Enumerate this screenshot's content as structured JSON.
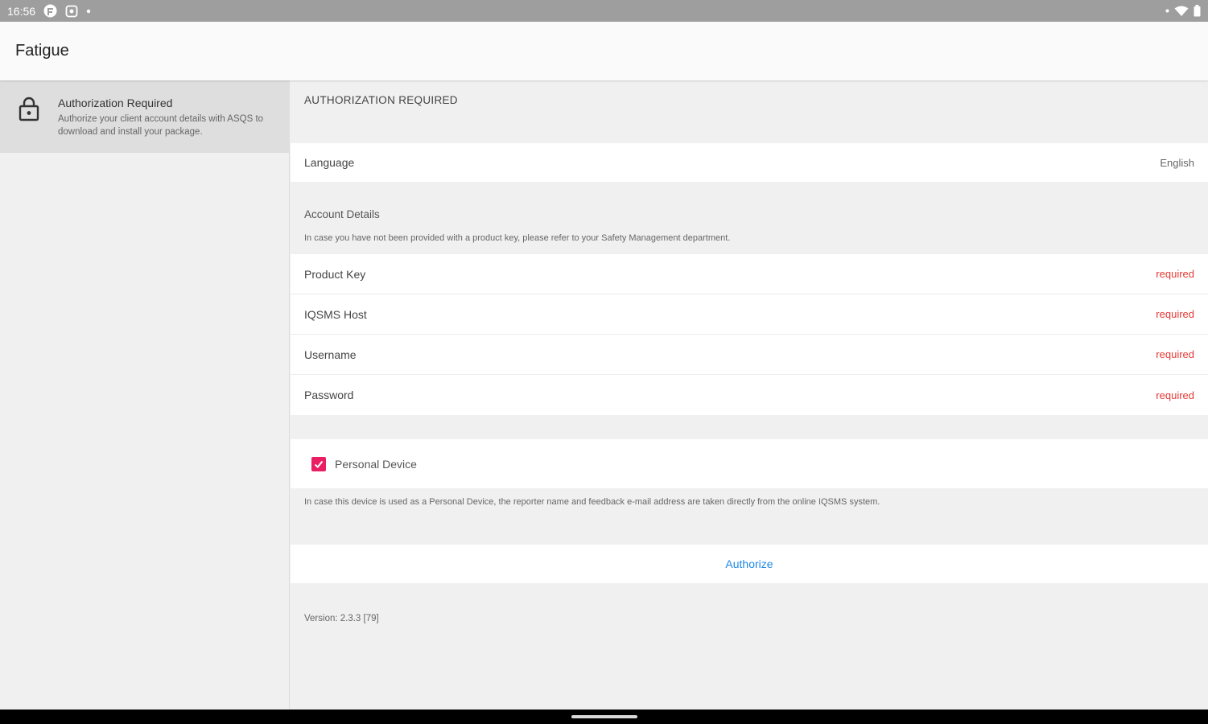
{
  "status_bar": {
    "time": "16:56",
    "icons": [
      "app-notification-icon",
      "settings-notification-icon",
      "dot-icon",
      "wifi-icon",
      "battery-icon"
    ]
  },
  "app_bar": {
    "title": "Fatigue"
  },
  "sidebar": {
    "items": [
      {
        "icon": "lock-icon",
        "title": "Authorization Required",
        "subtitle": "Authorize your client account details with ASQS to download and install your package."
      }
    ]
  },
  "main": {
    "section_header": "AUTHORIZATION REQUIRED",
    "language": {
      "label": "Language",
      "value": "English"
    },
    "account_details": {
      "title": "Account Details",
      "note": "In case you have not been provided with a product key, please refer to your Safety Management department."
    },
    "fields": [
      {
        "label": "Product Key",
        "status": "required"
      },
      {
        "label": "IQSMS Host",
        "status": "required"
      },
      {
        "label": "Username",
        "status": "required"
      },
      {
        "label": "Password",
        "status": "required"
      }
    ],
    "personal_device": {
      "label": "Personal Device",
      "checked": true,
      "note": "In case this device is used as a Personal Device, the reporter name and feedback e-mail address are taken directly from the online IQSMS system."
    },
    "authorize_label": "Authorize",
    "version": "Version: 2.3.3 [79]"
  },
  "colors": {
    "accent_pink": "#e91e63",
    "required_red": "#e53935",
    "link_blue": "#1e88e5"
  }
}
